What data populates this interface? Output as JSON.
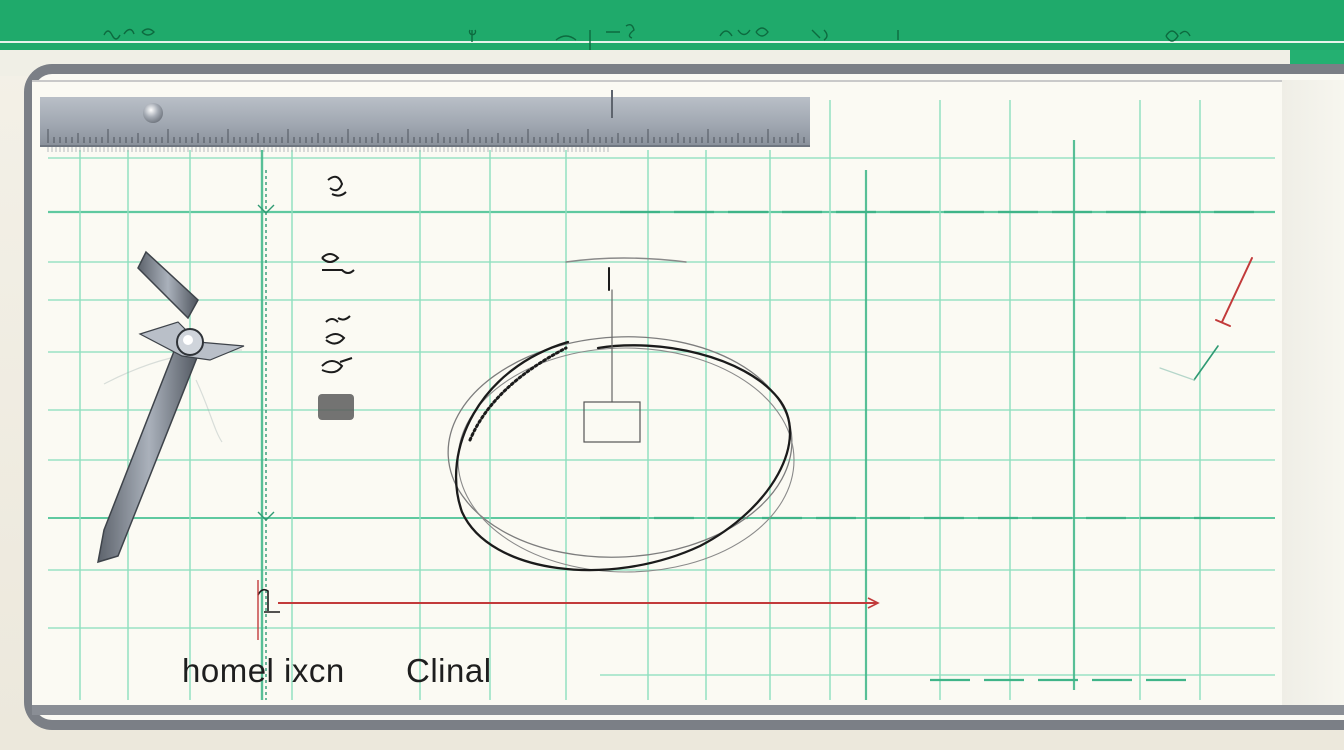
{
  "canvas": {
    "caption_left": "homel ixcn",
    "caption_right": "Clinal"
  },
  "colors": {
    "brand_green": "#1faa6b",
    "grid_teal": "#7ed8b4",
    "frame_gray": "#7b7f86",
    "ruler_gray": "#a3aab3",
    "sketch_ink": "#1b1b1b",
    "marker_red": "#c23a3a"
  },
  "icons": {
    "ruler": "ruler-icon",
    "compass": "compass-icon",
    "pin": "pin-icon"
  }
}
